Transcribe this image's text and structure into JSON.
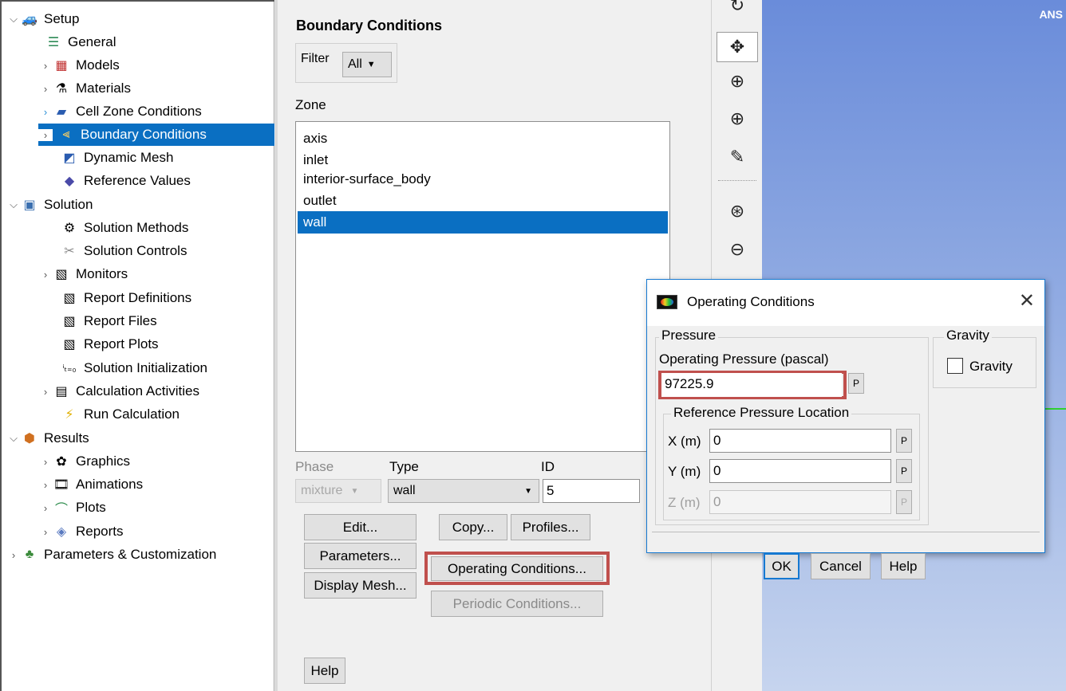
{
  "tree": {
    "items": [
      {
        "label": "Setup",
        "icon": "setup-icon",
        "arrow": "expanded"
      },
      {
        "label": "General",
        "icon": "general-icon",
        "arrow": ""
      },
      {
        "label": "Models",
        "icon": "models-icon",
        "arrow": "collapsed"
      },
      {
        "label": "Materials",
        "icon": "materials-icon",
        "arrow": "collapsed"
      },
      {
        "label": "Cell Zone Conditions",
        "icon": "cell-zone-icon",
        "arrow": "collapsed"
      },
      {
        "label": "Boundary Conditions",
        "icon": "boundary-icon",
        "arrow": "collapsed"
      },
      {
        "label": "Dynamic Mesh",
        "icon": "dynamic-mesh-icon",
        "arrow": ""
      },
      {
        "label": "Reference Values",
        "icon": "reference-values-icon",
        "arrow": ""
      },
      {
        "label": "Solution",
        "icon": "solution-icon",
        "arrow": "expanded"
      },
      {
        "label": "Solution Methods",
        "icon": "solution-methods-icon",
        "arrow": ""
      },
      {
        "label": "Solution Controls",
        "icon": "solution-controls-icon",
        "arrow": ""
      },
      {
        "label": "Monitors",
        "icon": "monitors-icon",
        "arrow": "collapsed"
      },
      {
        "label": "Report Definitions",
        "icon": "report-definitions-icon",
        "arrow": ""
      },
      {
        "label": "Report Files",
        "icon": "report-files-icon",
        "arrow": ""
      },
      {
        "label": "Report Plots",
        "icon": "report-plots-icon",
        "arrow": ""
      },
      {
        "label": "Solution Initialization",
        "icon": "solution-init-icon",
        "arrow": ""
      },
      {
        "label": "Calculation Activities",
        "icon": "calc-activities-icon",
        "arrow": "collapsed"
      },
      {
        "label": "Run Calculation",
        "icon": "run-calculation-icon",
        "arrow": ""
      },
      {
        "label": "Results",
        "icon": "results-icon",
        "arrow": "expanded"
      },
      {
        "label": "Graphics",
        "icon": "graphics-icon",
        "arrow": "collapsed"
      },
      {
        "label": "Animations",
        "icon": "animations-icon",
        "arrow": "collapsed"
      },
      {
        "label": "Plots",
        "icon": "plots-icon",
        "arrow": "collapsed"
      },
      {
        "label": "Reports",
        "icon": "reports-icon",
        "arrow": "collapsed"
      },
      {
        "label": "Parameters & Customization",
        "icon": "parameters-icon",
        "arrow": "collapsed"
      }
    ],
    "selected": "Boundary Conditions"
  },
  "boundary": {
    "title": "Boundary Conditions",
    "filter_label": "Filter",
    "filter_value": "All",
    "zone_label": "Zone",
    "zones": [
      "axis",
      "inlet",
      "interior-surface_body",
      "outlet",
      "wall"
    ],
    "selected_zone": "wall",
    "phase_label": "Phase",
    "phase_value": "mixture",
    "type_label": "Type",
    "type_value": "wall",
    "id_label": "ID",
    "id_value": "5",
    "buttons": {
      "edit": "Edit...",
      "copy": "Copy...",
      "profiles": "Profiles...",
      "parameters": "Parameters...",
      "operating": "Operating Conditions...",
      "display_mesh": "Display Mesh...",
      "periodic": "Periodic Conditions...",
      "help": "Help"
    }
  },
  "toolbar": {
    "tools": [
      "rotate-icon",
      "pan-icon",
      "zoom-fit-icon",
      "zoom-in-icon",
      "probe-icon",
      "zoom-box-icon",
      "zoom-out-icon"
    ]
  },
  "graphics": {
    "brand": "ANS"
  },
  "operating_dialog": {
    "title": "Operating Conditions",
    "pressure_group": "Pressure",
    "operating_pressure_label": "Operating Pressure (pascal)",
    "operating_pressure_value": "97225.9",
    "param_btn": "P",
    "ref_location_group": "Reference Pressure Location",
    "x_label": "X (m)",
    "x_value": "0",
    "y_label": "Y (m)",
    "y_value": "0",
    "z_label": "Z (m)",
    "z_value": "0",
    "gravity_group": "Gravity",
    "gravity_label": "Gravity",
    "gravity_checked": false,
    "ok": "OK",
    "cancel": "Cancel",
    "help": "Help"
  },
  "colors": {
    "selection": "#0a6fc2",
    "highlight": "#c0504d",
    "dialog_border": "#1679d1"
  }
}
